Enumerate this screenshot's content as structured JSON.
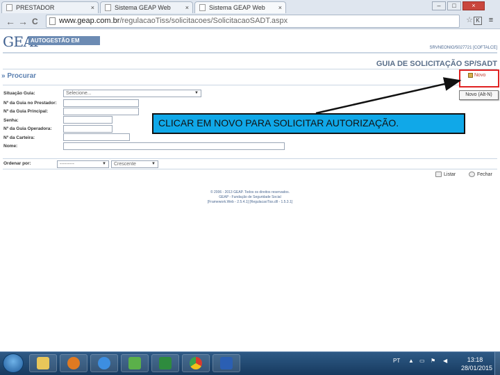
{
  "browser": {
    "tabs": [
      {
        "label": "PRESTADOR",
        "close": "×"
      },
      {
        "label": "Sistema GEAP Web",
        "close": "×"
      },
      {
        "label": "Sistema GEAP Web",
        "close": "×"
      }
    ],
    "window_buttons": {
      "minimize": "–",
      "maximize": "□",
      "close": "×"
    },
    "nav": {
      "back": "←",
      "forward": "→",
      "reload": "C"
    },
    "url_host": "www.geap.com.br",
    "url_path": "/regulacaoTiss/solicitacoes/SolicitacaoSADT.aspx"
  },
  "header": {
    "logo_text": "GEAP",
    "logo_subtitle": "AUTOGESTÃO EM SAÚDE",
    "user_line": "SRVNEONIO/5027721 [COFTALCE]",
    "page_title": "GUIA DE SOLICITAÇÃO SP/SADT"
  },
  "search": {
    "section_label": "» Procurar",
    "new_label": "Novo",
    "new_tooltip": "Novo (Alt-N)",
    "fields": {
      "situacao_label": "Situação Guia:",
      "situacao_value": "Selecione...",
      "guia_prestador_label": "Nº da Guia no Prestador:",
      "guia_principal_label": "Nº da Guia Principal:",
      "senha_label": "Senha:",
      "guia_operadora_label": "Nº da Guia Operadora:",
      "carteira_label": "Nº da Carteira:",
      "nome_label": "Nome:"
    },
    "order": {
      "label": "Ordenar por:",
      "field_value": "---------",
      "direction_value": "Crescente"
    },
    "actions": {
      "listar": "Listar",
      "fechar": "Fechar"
    }
  },
  "footer": {
    "line1": "© 2006 - 2013 GEAP. Todos os direitos reservados.",
    "line2": "GEAP - Fundação de Seguridade Social",
    "line3": "[Framework.Web - 2.5.4.1] [RegulacaoTiss.dll - 1.5.3.1]"
  },
  "annotation": {
    "callout_text": "CLICAR EM NOVO PARA SOLICITAR AUTORIZAÇÃO."
  },
  "taskbar": {
    "lang": "PT",
    "time": "13:18",
    "date": "28/01/2015"
  },
  "colors": {
    "callout_bg": "#10a8e8",
    "highlight_box": "#e02020",
    "brand_blue": "#3e5f8f"
  }
}
